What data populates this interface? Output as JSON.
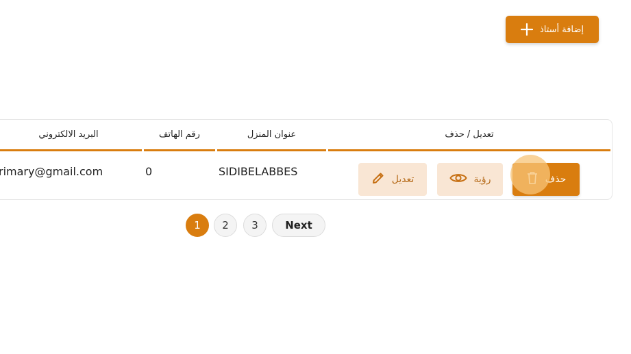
{
  "toolbar": {
    "add_teacher_label": "إضافة أستاذ"
  },
  "table": {
    "headers": {
      "actions": "تعديل / حذف",
      "address": "عنوان المنزل",
      "phone": "رقم الهاتف",
      "email": "البريد الالكتروني"
    },
    "rows": [
      {
        "email": "rimary@gmail.com",
        "phone": "0",
        "address": "SIDIBELABBES",
        "edit_label": "تعديل",
        "view_label": "رؤية",
        "delete_label": "حذف"
      }
    ]
  },
  "pagination": {
    "pages": [
      "1",
      "2",
      "3"
    ],
    "current": "1",
    "next_label": "Next"
  },
  "colors": {
    "accent": "#d97d0f",
    "accent_light": "#f9e6d4"
  },
  "icons": {
    "add": "plus-icon",
    "edit": "pencil-icon",
    "view": "eye-icon",
    "delete": "trash-icon"
  }
}
